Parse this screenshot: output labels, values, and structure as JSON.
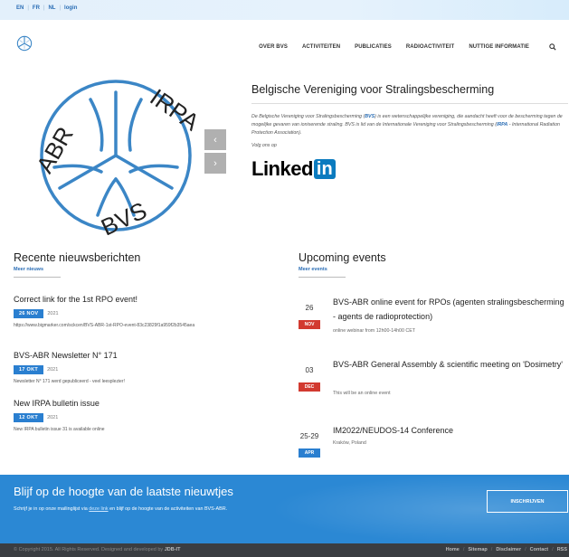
{
  "top": {
    "languages": [
      "EN",
      "FR",
      "NL"
    ],
    "login": "login"
  },
  "nav": {
    "items": [
      "OVER BVS",
      "ACTIVITEITEN",
      "PUBLICATIES",
      "RADIOACTIVITEIT",
      "NUTTIGE INFORMATIE"
    ],
    "search_icon": "search-icon"
  },
  "hero": {
    "logo_texts": [
      "IRPA",
      "ABR",
      "BVS"
    ],
    "title": "Belgische Vereniging voor Stralingsbescherming",
    "desc_1": "De Belgische Vereniging voor Stralingsbescherming (",
    "desc_bvs": "BVS",
    "desc_2": ") is een wetenschappelijke vereniging, die aandacht heeft voor de bescherming tegen de mogelijke gevaren van ioniserende straling. BVS is lid van de Internationale Vereniging voor Stralingsbescherming (",
    "desc_irpa": "IRPA",
    "desc_3": " - International Radiation Protection Association).",
    "follow": "Volg ons op",
    "linkedin_text": "Linked",
    "linkedin_box": "in",
    "prev_icon": "chevron-left-icon",
    "next_icon": "chevron-right-icon"
  },
  "news": {
    "title": "Recente nieuwsberichten",
    "more": "Meer nieuws",
    "items": [
      {
        "title": "Correct link for the 1st RPO event!",
        "badge": "26 NOV",
        "year": "2021",
        "text": "https://www.bigmarker.com/sckcen/BVS-ABR-1st-RPO-event-83c23829f1a959f2b3545aea"
      },
      {
        "title": "BVS-ABR Newsletter N° 171",
        "badge": "17 OKT",
        "year": "2021",
        "text": "Newsletter N° 171 werd gepubliceerd - veel leesplezier!"
      },
      {
        "title": "New IRPA bulletin issue",
        "badge": "12 OKT",
        "year": "2021",
        "text": "New IRPA bulletin issue 31 is available online"
      }
    ]
  },
  "events": {
    "title": "Upcoming events",
    "more": "Meer events",
    "items": [
      {
        "day": "26",
        "month": "NOV",
        "color": "#d23a30",
        "title": "BVS-ABR online event for RPOs (agenten stralingsbescherming - agents de radioprotection)",
        "sub": "online webinar from 12h00-14h00 CET"
      },
      {
        "day": "03",
        "month": "DEC",
        "color": "#d23a30",
        "title": "BVS-ABR General Assembly & scientific meeting on 'Dosimetry'",
        "sub": "This will be an online event"
      },
      {
        "day": "25-29",
        "month": "APR",
        "color": "#2a7fd0",
        "title": "IM2022/NEUDOS-14 Conference",
        "sub": "Kraków, Poland"
      }
    ]
  },
  "newsletter": {
    "title": "Blijf op de hoogte van de laatste nieuwtjes",
    "text_1": "Schrijf je in op onze mailinglijst via ",
    "link": "deze link",
    "text_2": " en blijf op de hoogte van de activiteiten van BVS-ABR.",
    "button": "INSCHRIJVEN"
  },
  "footer": {
    "copyright": "© Copyright 2015. All Rights Reserved. Designed and developed by ",
    "developer": "JDB-IT",
    "links": [
      "Home",
      "Sitemap",
      "Disclaimer",
      "Contact",
      "RSS"
    ]
  },
  "colors": {
    "brand_blue": "#2a7fd0",
    "logo_blue": "#3b86c6",
    "event_red": "#d23a30",
    "footer": "#3a3d41"
  }
}
